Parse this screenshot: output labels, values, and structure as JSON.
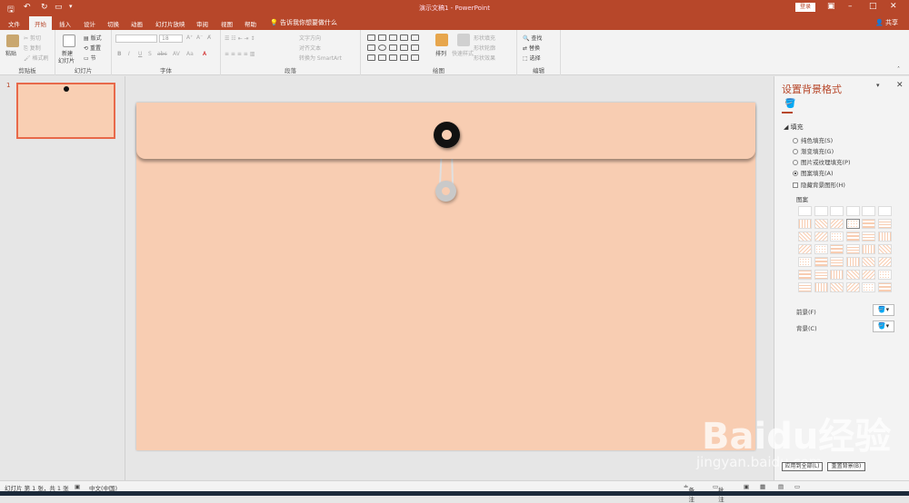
{
  "window": {
    "title": "演示文稿1 - PowerPoint",
    "login": "登录"
  },
  "tabs": [
    "文件",
    "开始",
    "插入",
    "设计",
    "切换",
    "动画",
    "幻灯片放映",
    "审阅",
    "视图",
    "帮助"
  ],
  "active_tab": "开始",
  "tellme": "告诉我你想要做什么",
  "share": "共享",
  "ribbon": {
    "clipboard": {
      "label": "剪贴板",
      "paste": "粘贴",
      "cut": "剪切",
      "copy": "复制",
      "format_painter": "格式刷"
    },
    "slides": {
      "label": "幻灯片",
      "new_slide": "新建",
      "new_slide2": "幻灯片",
      "layout": "版式",
      "reset": "重置",
      "section": "节"
    },
    "font": {
      "label": "字体",
      "size": "18",
      "buttons": [
        "B",
        "I",
        "U",
        "S",
        "abc",
        "AV",
        "Aa",
        "A"
      ]
    },
    "paragraph": {
      "label": "段落",
      "text_direction": "文字方向",
      "align_text": "对齐文本",
      "smartart": "转换为 SmartArt"
    },
    "drawing": {
      "label": "绘图",
      "arrange": "排列",
      "quick_styles": "快速样式",
      "shape_fill": "形状填充",
      "shape_outline": "形状轮廓",
      "shape_effects": "形状效果"
    },
    "editing": {
      "label": "编辑",
      "find": "查找",
      "replace": "替换",
      "select": "选择"
    }
  },
  "thumbnail": {
    "number": "1"
  },
  "format_pane": {
    "title": "设置背景格式",
    "section": "填充",
    "options": [
      "纯色填充(S)",
      "渐变填充(G)",
      "图片或纹理填充(P)",
      "图案填充(A)"
    ],
    "selected": "图案填充(A)",
    "hide_graphics": "隐藏背景图形(H)",
    "pattern_label": "图案",
    "foreground_label": "前景(F)",
    "background_label": "背景(C)"
  },
  "overlay_buttons": {
    "apply_all": "应用到全部(L)",
    "reset": "重置背景(B)"
  },
  "status": {
    "slide": "幻灯片 第 1 张，共 1 张",
    "language": "中文(中国)",
    "notes": "备注",
    "comments": "批注"
  },
  "watermark": {
    "brand": "Baidu经验",
    "url": "jingyan.baidu.com"
  },
  "colors": {
    "accent": "#b7472a",
    "envelope": "#f8cdb2"
  }
}
